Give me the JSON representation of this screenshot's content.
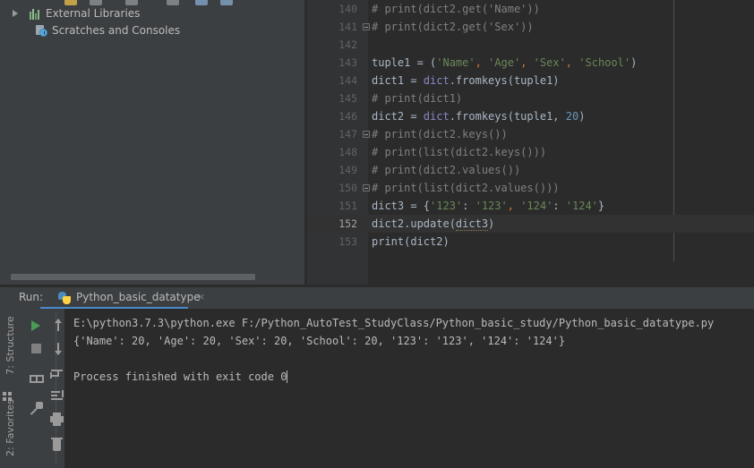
{
  "project_tree": {
    "items": [
      {
        "label": "External Libraries",
        "icon": "libraries-icon",
        "expandable": true,
        "indent": 33
      },
      {
        "label": "Scratches and Consoles",
        "icon": "scratches-icon",
        "expandable": false,
        "indent": 40
      }
    ]
  },
  "editor": {
    "first_line_number": 140,
    "current_line": 152,
    "lines": [
      {
        "num": "140",
        "fold": false,
        "indent": 0,
        "tokens": [
          {
            "t": "# print(dict2.get('Name'))",
            "c": "cm"
          }
        ]
      },
      {
        "num": "141",
        "fold": true,
        "indent": 0,
        "tokens": [
          {
            "t": "# print(dict2.get('Sex'))",
            "c": "cm"
          }
        ]
      },
      {
        "num": "142",
        "fold": false,
        "indent": 0,
        "tokens": []
      },
      {
        "num": "143",
        "fold": false,
        "indent": 0,
        "tokens": [
          {
            "t": "tuple1 = (",
            "c": "pn"
          },
          {
            "t": "'Name'",
            "c": "st"
          },
          {
            "t": ",",
            "c": "cma"
          },
          {
            "t": " ",
            "c": "pn"
          },
          {
            "t": "'Age'",
            "c": "st"
          },
          {
            "t": ",",
            "c": "cma"
          },
          {
            "t": " ",
            "c": "pn"
          },
          {
            "t": "'Sex'",
            "c": "st"
          },
          {
            "t": ",",
            "c": "cma"
          },
          {
            "t": " ",
            "c": "pn"
          },
          {
            "t": "'School'",
            "c": "st"
          },
          {
            "t": ")",
            "c": "pn"
          }
        ]
      },
      {
        "num": "144",
        "fold": false,
        "indent": 0,
        "tokens": [
          {
            "t": "dict1 = ",
            "c": "pn"
          },
          {
            "t": "dict",
            "c": "bi"
          },
          {
            "t": ".fromkeys(tuple1)",
            "c": "pn"
          }
        ]
      },
      {
        "num": "145",
        "fold": false,
        "indent": 0,
        "tokens": [
          {
            "t": "# print(dict1)",
            "c": "cm"
          }
        ]
      },
      {
        "num": "146",
        "fold": false,
        "indent": 0,
        "tokens": [
          {
            "t": "dict2 = ",
            "c": "pn"
          },
          {
            "t": "dict",
            "c": "bi"
          },
          {
            "t": ".fromkeys(tuple1, ",
            "c": "pn"
          },
          {
            "t": "20",
            "c": "nm"
          },
          {
            "t": ")",
            "c": "pn"
          }
        ]
      },
      {
        "num": "147",
        "fold": true,
        "indent": 0,
        "tokens": [
          {
            "t": "# print(dict2.keys())",
            "c": "cm"
          }
        ]
      },
      {
        "num": "148",
        "fold": false,
        "indent": 0,
        "tokens": [
          {
            "t": "# print(list(dict2.keys()))",
            "c": "cm"
          }
        ]
      },
      {
        "num": "149",
        "fold": false,
        "indent": 0,
        "tokens": [
          {
            "t": "# print(dict2.values())",
            "c": "cm"
          }
        ]
      },
      {
        "num": "150",
        "fold": true,
        "indent": 0,
        "tokens": [
          {
            "t": "# print(list(dict2.values()))",
            "c": "cm"
          }
        ]
      },
      {
        "num": "151",
        "fold": false,
        "indent": 0,
        "tokens": [
          {
            "t": "dict3 = {",
            "c": "pn"
          },
          {
            "t": "'123'",
            "c": "st"
          },
          {
            "t": ": ",
            "c": "pn"
          },
          {
            "t": "'123'",
            "c": "st"
          },
          {
            "t": ",",
            "c": "cma"
          },
          {
            "t": " ",
            "c": "pn"
          },
          {
            "t": "'124'",
            "c": "st"
          },
          {
            "t": ": ",
            "c": "pn"
          },
          {
            "t": "'124'",
            "c": "st"
          },
          {
            "t": "}",
            "c": "pn"
          }
        ]
      },
      {
        "num": "152",
        "fold": false,
        "indent": 0,
        "tokens": [
          {
            "t": "dict2.update(",
            "c": "pn"
          },
          {
            "t": "dict3",
            "c": "pn squig"
          },
          {
            "t": ")",
            "c": "pn"
          }
        ]
      },
      {
        "num": "153",
        "fold": false,
        "indent": 0,
        "tokens": [
          {
            "t": "print",
            "c": "pn"
          },
          {
            "t": "(dict2)",
            "c": "pn"
          }
        ]
      }
    ]
  },
  "run_panel": {
    "label": "Run:",
    "tab_label": "Python_basic_datatype",
    "tab_close": "×",
    "toolbar": [
      {
        "name": "run-button",
        "icon": "play-icon"
      },
      {
        "name": "stop-button",
        "icon": "stop-icon"
      },
      {
        "name": "print-output-button",
        "icon": "print-icon"
      },
      {
        "name": "pin-tab-button",
        "icon": "pin-icon"
      },
      {
        "name": "scroll-up-button",
        "icon": "arrow-up-icon"
      },
      {
        "name": "scroll-down-button",
        "icon": "arrow-down-icon"
      },
      {
        "name": "soft-wrap-button",
        "icon": "wrap-icon"
      },
      {
        "name": "scroll-to-end-button",
        "icon": "scroll-end-icon"
      },
      {
        "name": "print-button",
        "icon": "printer-icon"
      },
      {
        "name": "clear-all-button",
        "icon": "trash-icon"
      }
    ],
    "console_lines": [
      "E:\\python3.7.3\\python.exe F:/Python_AutoTest_StudyClass/Python_basic_study/Python_basic_datatype.py",
      "{'Name': 20, 'Age': 20, 'Sex': 20, 'School': 20, '123': '123', '124': '124'}",
      "",
      "Process finished with exit code 0"
    ],
    "caret_line_index": 3
  },
  "tool_windows": {
    "structure": "7: Structure",
    "favorites": "2: Favorites"
  },
  "colors": {
    "background": "#3c3f41",
    "editor_bg": "#2b2b2b",
    "gutter_bg": "#313335",
    "accent": "#4a88c7",
    "run_green": "#499c54",
    "string": "#6a8759",
    "number": "#6897bb",
    "builtin": "#8888c6",
    "comment": "#808080",
    "comma": "#cc7832",
    "text": "#a9b7c6"
  }
}
